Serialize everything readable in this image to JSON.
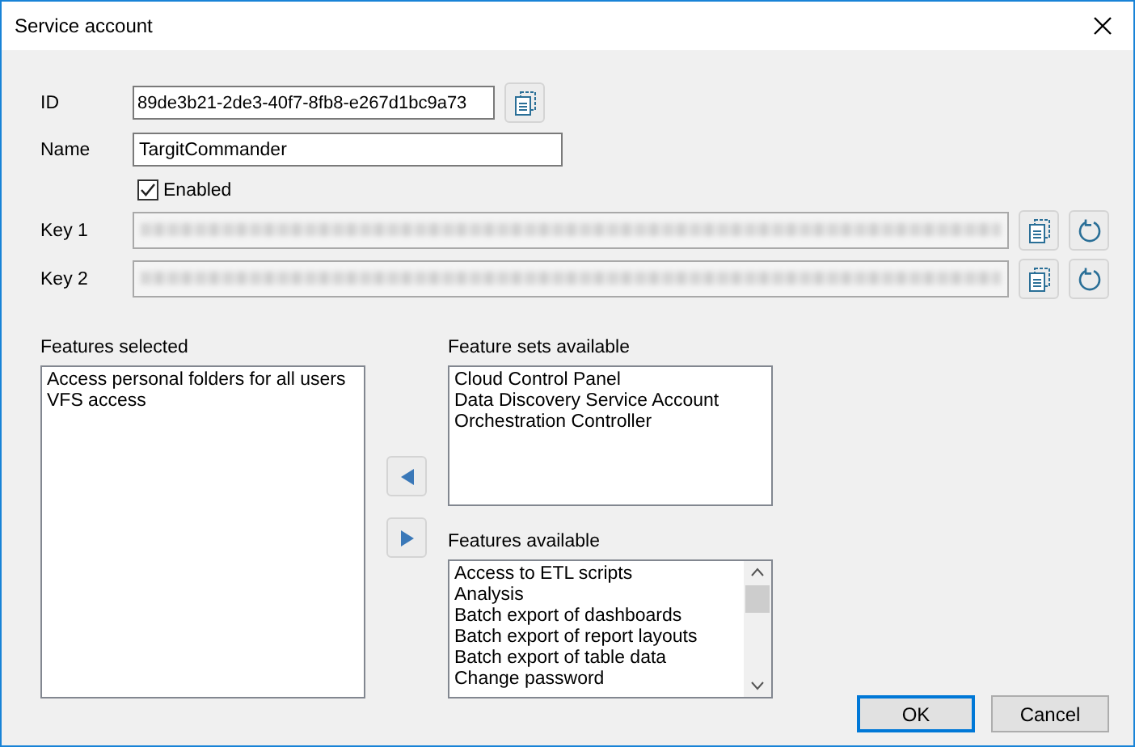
{
  "window": {
    "title": "Service account"
  },
  "fields": {
    "id": {
      "label": "ID",
      "value": "89de3b21-2de3-40f7-8fb8-e267d1bc9a73"
    },
    "name": {
      "label": "Name",
      "value": "TargitCommander"
    },
    "enabled": {
      "label": "Enabled",
      "checked": true
    },
    "keys": [
      {
        "label": "Key 1"
      },
      {
        "label": "Key 2"
      }
    ]
  },
  "features_selected": {
    "label": "Features selected",
    "items": [
      "Access personal folders for all users",
      "VFS access"
    ]
  },
  "feature_sets_available": {
    "label": "Feature sets available",
    "items": [
      "Cloud Control Panel",
      "Data Discovery Service Account",
      "Orchestration Controller"
    ]
  },
  "features_available": {
    "label": "Features available",
    "items": [
      "Access to ETL scripts",
      "Analysis",
      "Batch export of dashboards",
      "Batch export of report layouts",
      "Batch export of table data",
      "Change password"
    ]
  },
  "buttons": [
    {
      "label": "OK",
      "default": true
    },
    {
      "label": "Cancel",
      "default": false
    }
  ]
}
